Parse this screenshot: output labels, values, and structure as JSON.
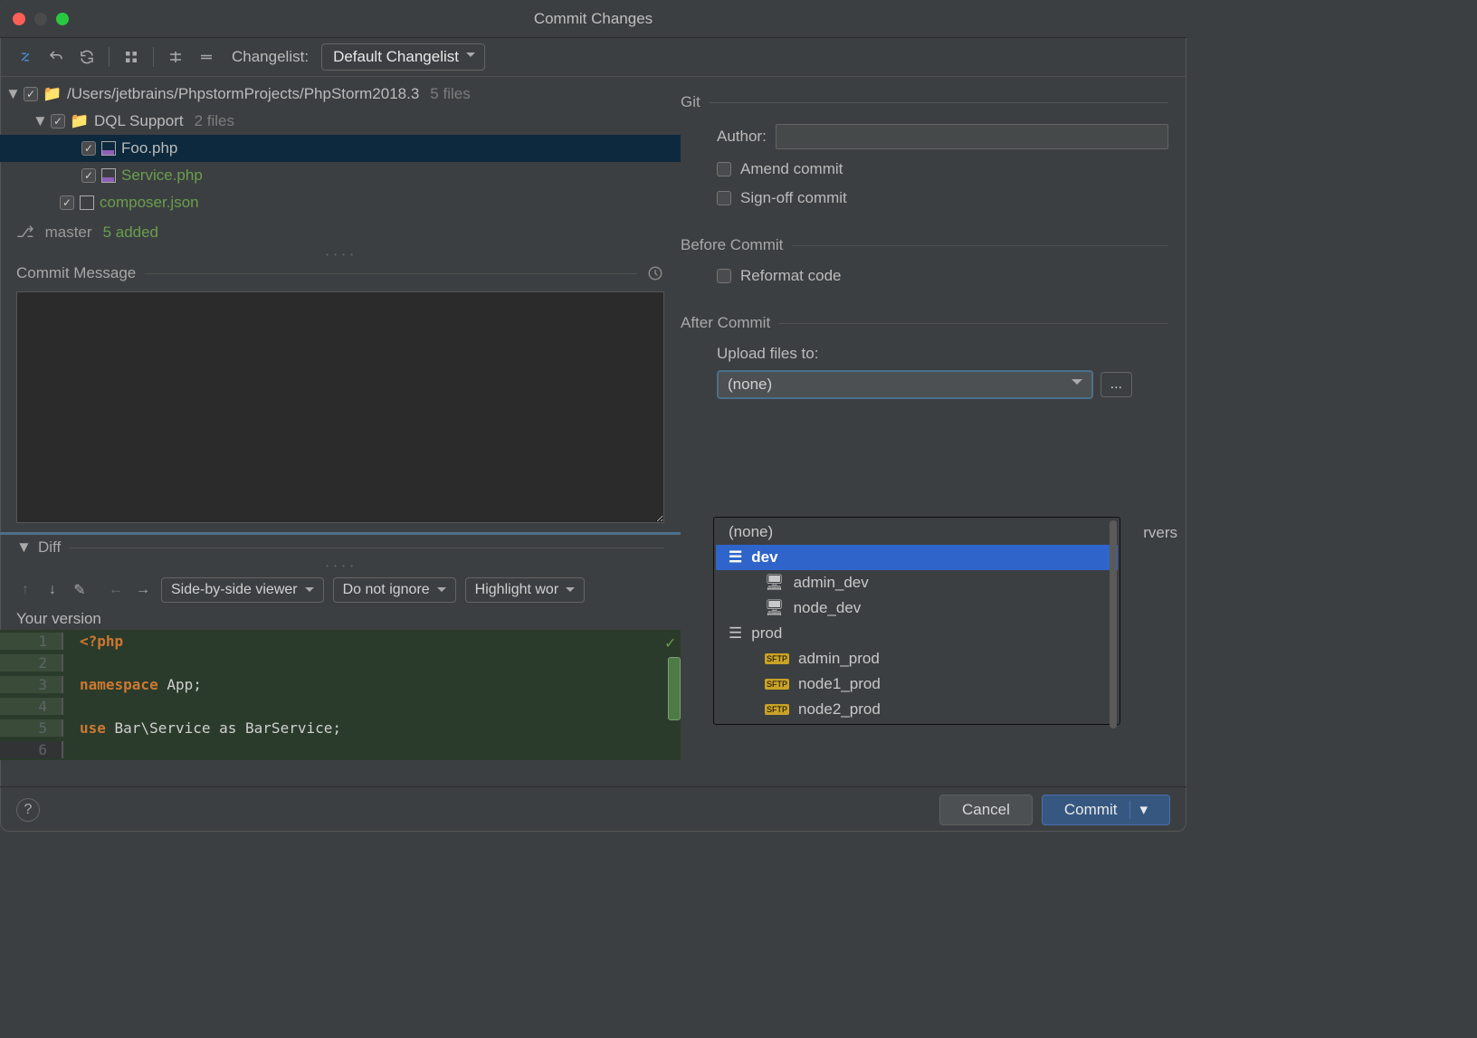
{
  "window": {
    "title": "Commit Changes"
  },
  "toolbar": {
    "changelist_label": "Changelist:",
    "changelist_value": "Default Changelist"
  },
  "tree": {
    "root": {
      "path": "/Users/jetbrains/PhpstormProjects/PhpStorm2018.3",
      "count": "5 files"
    },
    "folder": {
      "name": "DQL Support",
      "count": "2 files"
    },
    "files": [
      {
        "name": "Foo.php",
        "added": false
      },
      {
        "name": "Service.php",
        "added": true
      },
      {
        "name": "composer.json",
        "added": true
      }
    ]
  },
  "branch": {
    "name": "master",
    "status": "5 added"
  },
  "commit_message_label": "Commit Message",
  "diff_section_label": "Diff",
  "diff_toolbar": {
    "viewer": "Side-by-side viewer",
    "ignore": "Do not ignore",
    "highlight": "Highlight wor"
  },
  "diff_header": "Your version",
  "code": {
    "lines": [
      {
        "n": "1",
        "kw": "<?php",
        "rest": ""
      },
      {
        "n": "2",
        "kw": "",
        "rest": ""
      },
      {
        "n": "3",
        "kw": "namespace",
        "rest": " App;"
      },
      {
        "n": "4",
        "kw": "",
        "rest": ""
      },
      {
        "n": "5",
        "kw": "use",
        "rest": " Bar\\Service as BarService;"
      },
      {
        "n": "6",
        "kw": "",
        "rest": ""
      }
    ]
  },
  "git": {
    "section": "Git",
    "author_label": "Author:",
    "amend_label": "Amend commit",
    "signoff_label": "Sign-off commit"
  },
  "before": {
    "section": "Before Commit",
    "reformat_label": "Reformat code"
  },
  "after": {
    "section": "After Commit",
    "upload_label": "Upload files to:",
    "selected": "(none)",
    "partial": "rvers"
  },
  "dropdown": {
    "items": [
      {
        "label": "(none)",
        "indent": 0,
        "icon": ""
      },
      {
        "label": "dev",
        "indent": 0,
        "icon": "group",
        "selected": true
      },
      {
        "label": "admin_dev",
        "indent": 1,
        "icon": "host"
      },
      {
        "label": "node_dev",
        "indent": 1,
        "icon": "host"
      },
      {
        "label": "prod",
        "indent": 0,
        "icon": "group"
      },
      {
        "label": "admin_prod",
        "indent": 1,
        "icon": "sftp"
      },
      {
        "label": "node1_prod",
        "indent": 1,
        "icon": "sftp"
      },
      {
        "label": "node2_prod",
        "indent": 1,
        "icon": "sftp"
      }
    ]
  },
  "buttons": {
    "help": "?",
    "cancel": "Cancel",
    "commit": "Commit"
  }
}
